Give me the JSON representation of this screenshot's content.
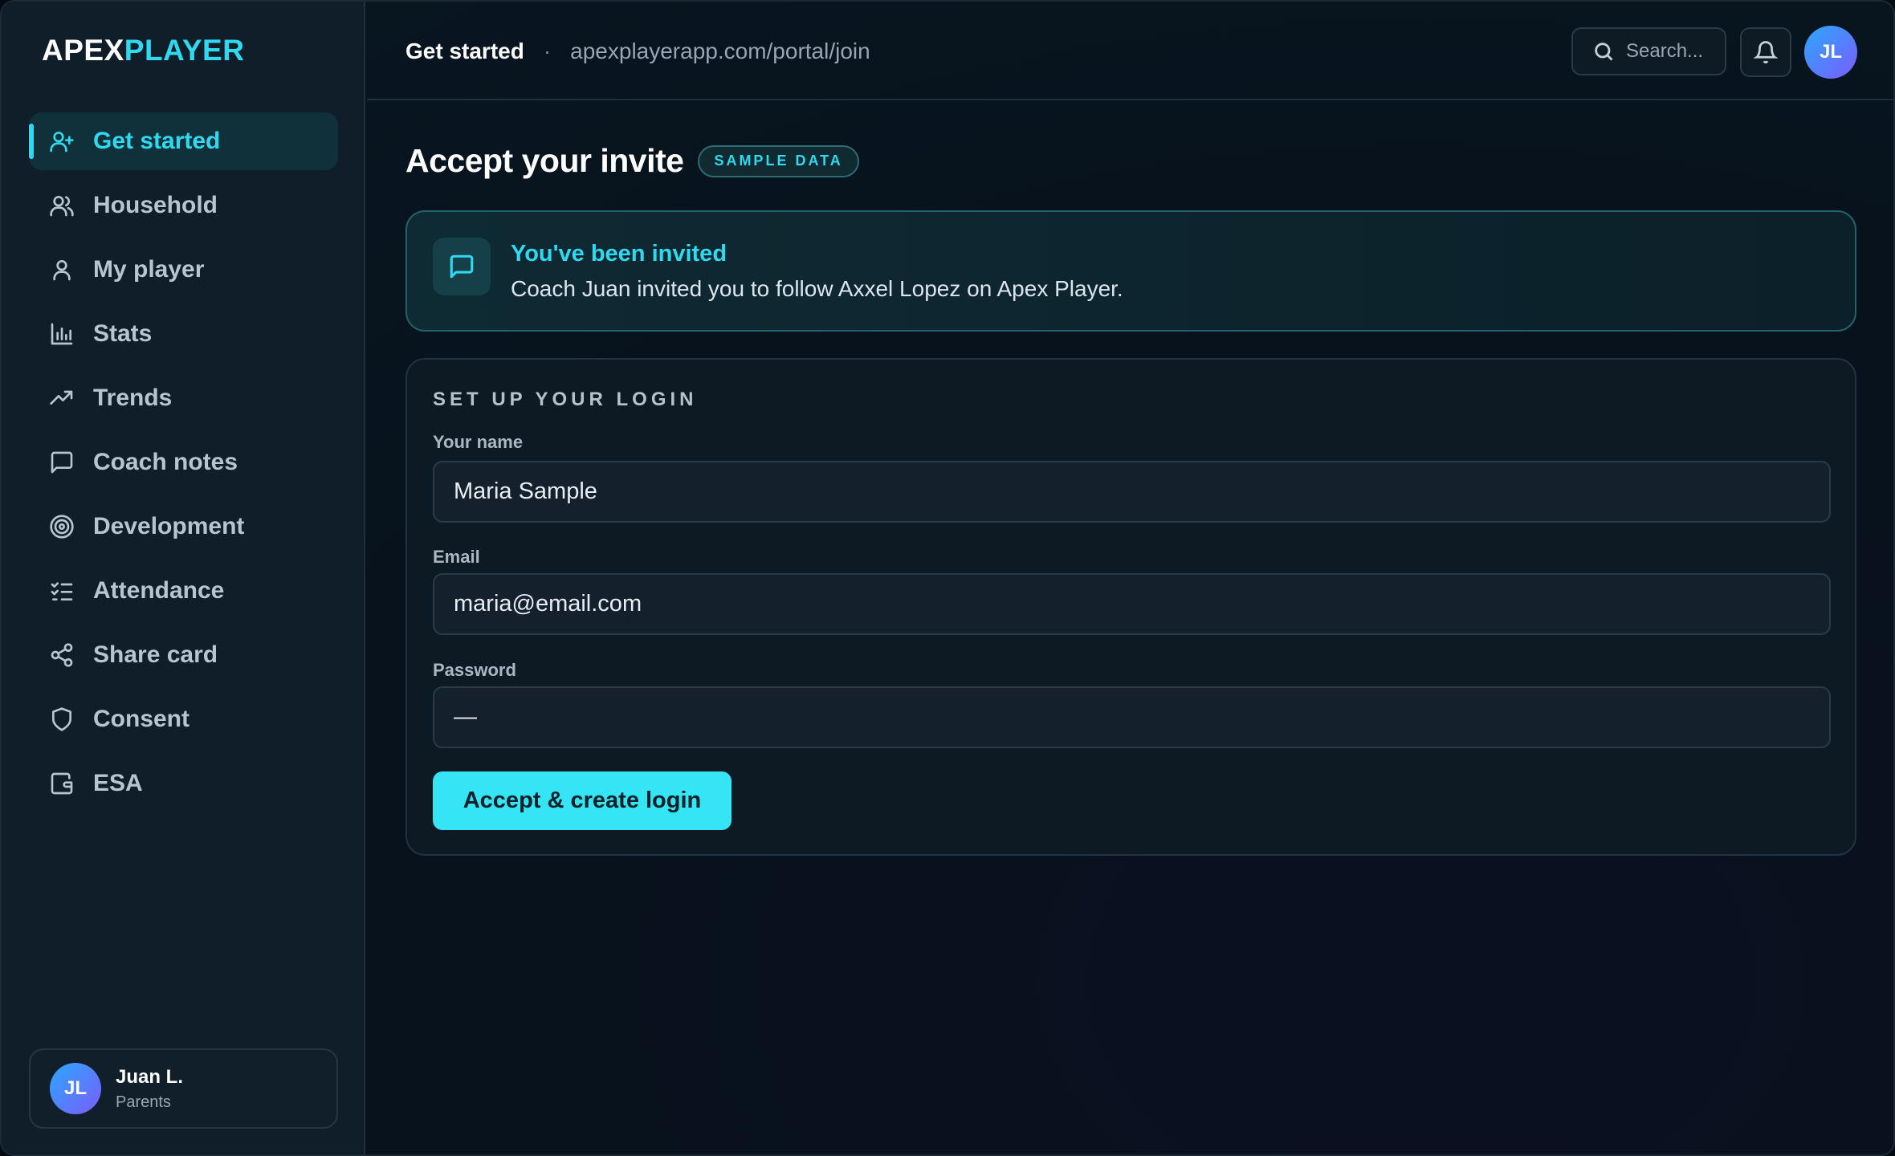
{
  "app": {
    "logo_part1": "APEX",
    "logo_part2": "PLAYER",
    "accent": "#2fd9f0"
  },
  "sidebar": {
    "items": [
      {
        "label": "Get started",
        "icon": "user-plus-icon",
        "active": true
      },
      {
        "label": "Household",
        "icon": "users-icon"
      },
      {
        "label": "My player",
        "icon": "user-icon"
      },
      {
        "label": "Stats",
        "icon": "bar-chart-icon"
      },
      {
        "label": "Trends",
        "icon": "trending-up-icon"
      },
      {
        "label": "Coach notes",
        "icon": "message-square-icon"
      },
      {
        "label": "Development",
        "icon": "target-icon"
      },
      {
        "label": "Attendance",
        "icon": "list-checks-icon"
      },
      {
        "label": "Share card",
        "icon": "share-icon"
      },
      {
        "label": "Consent",
        "icon": "shield-icon"
      },
      {
        "label": "ESA",
        "icon": "wallet-icon"
      }
    ],
    "user": {
      "initials": "JL",
      "name": "Juan L.",
      "role": "Parents"
    }
  },
  "header": {
    "title": "Get started",
    "separator": "·",
    "url": "apexplayerapp.com/portal/join",
    "search_placeholder": "Search...",
    "avatar_initials": "JL"
  },
  "main": {
    "page_title": "Accept your invite",
    "badge": "SAMPLE DATA",
    "invite": {
      "title": "You've been invited",
      "text": "Coach Juan invited you to follow Axxel Lopez on Apex Player."
    },
    "form": {
      "section_title": "SET UP YOUR LOGIN",
      "name_label": "Your name",
      "name_value": "Maria Sample",
      "email_label": "Email",
      "email_value": "maria@email.com",
      "password_label": "Password",
      "password_value": "—",
      "submit_label": "Accept & create login"
    }
  }
}
